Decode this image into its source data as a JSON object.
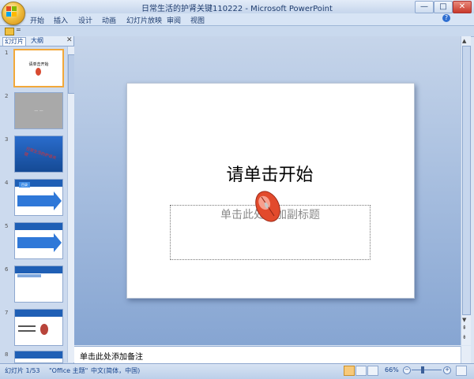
{
  "window": {
    "title": "日常生活的护肾关键110222 - Microsoft PowerPoint",
    "minimize": "—",
    "maximize": "□",
    "close": "✕"
  },
  "ribbon": {
    "tabs": [
      "开始",
      "插入",
      "设计",
      "动画",
      "幻灯片放映",
      "审阅",
      "视图"
    ]
  },
  "qat": {
    "dropdown": "="
  },
  "left_pane": {
    "tab_slides": "幻灯片",
    "tab_outline": "大纲",
    "close": "✕",
    "thumbnail_numbers": [
      "1",
      "2",
      "3",
      "4",
      "5",
      "6",
      "7",
      "8"
    ],
    "thumb1_title": "请单击开始",
    "thumb2_text": "— —",
    "thumb3_text": "日常生活的护肾关键",
    "thumb4_label": "目录"
  },
  "slide": {
    "title": "请单击开始",
    "subtitle_placeholder": "单击此处添加副标题"
  },
  "notes": {
    "placeholder": "单击此处添加备注"
  },
  "status": {
    "slide_count": "幻灯片 1/53",
    "theme": "\"Office 主题\"",
    "language": "中文(简体，中国)",
    "zoom": "66%"
  },
  "colors": {
    "ribbon_bg": "#d7e4f5",
    "workspace_top": "#c6d5ea",
    "workspace_bottom": "#86a5d2",
    "selected_thumb_border": "#f2a83a",
    "thumb_blue": "#1f5fb5"
  }
}
